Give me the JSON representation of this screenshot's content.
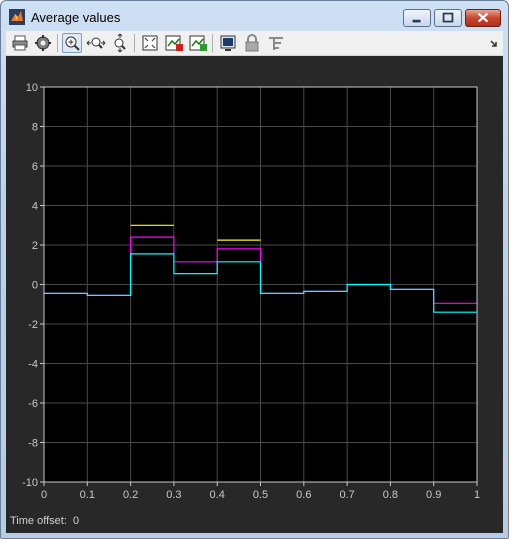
{
  "window": {
    "title": "Average values"
  },
  "toolbar": {
    "buttons": [
      {
        "name": "print",
        "icon": "printer-icon"
      },
      {
        "name": "parameters",
        "icon": "gear-icon"
      },
      {
        "name": "zoom-in",
        "icon": "zoom-in-icon",
        "active": true
      },
      {
        "name": "zoom-x",
        "icon": "zoom-x-icon"
      },
      {
        "name": "zoom-y",
        "icon": "zoom-y-icon"
      },
      {
        "name": "autoscale",
        "icon": "autoscale-icon"
      },
      {
        "name": "save-axes",
        "icon": "save-axes-icon"
      },
      {
        "name": "restore-axes",
        "icon": "restore-axes-icon"
      },
      {
        "name": "floating-scope",
        "icon": "floating-scope-icon"
      },
      {
        "name": "lock-axes",
        "icon": "lock-icon"
      },
      {
        "name": "signal-selection",
        "icon": "signal-selection-icon"
      }
    ]
  },
  "status": {
    "time_offset_label": "Time offset:",
    "time_offset_value": "0"
  },
  "colors": {
    "background": "#282828",
    "axes": "#000000",
    "grid": "#4a4a4a",
    "axis_line": "#c8c8c8",
    "tick_text": "#c8c8c8"
  },
  "chart_data": {
    "type": "line",
    "xlim": [
      0,
      1
    ],
    "ylim": [
      -10,
      10
    ],
    "xticks": [
      "0",
      "0.1",
      "0.2",
      "0.3",
      "0.4",
      "0.5",
      "0.6",
      "0.7",
      "0.8",
      "0.9",
      "1"
    ],
    "yticks": [
      "10",
      "8",
      "6",
      "4",
      "2",
      "0",
      "-2",
      "-4",
      "-6",
      "-8",
      "-10"
    ],
    "grid": true,
    "series": [
      {
        "color": "#ffff00",
        "x": [
          0.2,
          0.3
        ],
        "y": [
          3.0,
          3.0
        ]
      },
      {
        "color": "#ffff00",
        "x": [
          0.4,
          0.5
        ],
        "y": [
          2.25,
          2.25
        ]
      },
      {
        "color": "#ff00ff",
        "x": [
          0,
          0.1,
          0.1,
          0.2,
          0.2,
          0.3,
          0.3,
          0.4,
          0.4,
          0.5,
          0.5,
          0.6,
          0.6,
          0.7,
          0.7,
          0.8,
          0.8,
          0.9,
          0.9,
          1.0
        ],
        "y": [
          -0.45,
          -0.45,
          -0.55,
          -0.55,
          2.4,
          2.4,
          1.15,
          1.15,
          1.8,
          1.8,
          -0.45,
          -0.45,
          -0.35,
          -0.35,
          0.0,
          0.0,
          -0.25,
          -0.25,
          -0.95,
          -0.95
        ]
      },
      {
        "color": "#00ffff",
        "x": [
          0,
          0.1,
          0.1,
          0.2,
          0.2,
          0.3,
          0.3,
          0.4,
          0.4,
          0.5,
          0.5,
          0.6,
          0.6,
          0.7,
          0.7,
          0.8,
          0.8,
          0.9,
          0.9,
          1.0
        ],
        "y": [
          -0.45,
          -0.45,
          -0.55,
          -0.55,
          1.55,
          1.55,
          0.55,
          0.55,
          1.15,
          1.15,
          -0.45,
          -0.45,
          -0.35,
          -0.35,
          0.0,
          0.0,
          -0.25,
          -0.25,
          -1.4,
          -1.4
        ]
      }
    ]
  }
}
